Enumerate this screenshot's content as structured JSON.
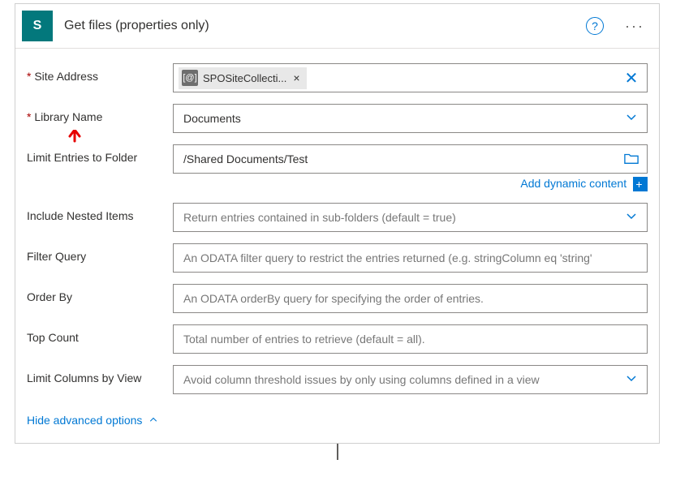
{
  "header": {
    "logo_letter": "S",
    "title": "Get files (properties only)"
  },
  "fields": {
    "site_address": {
      "label": "Site Address",
      "token": "SPOSiteCollecti..."
    },
    "library_name": {
      "label": "Library Name",
      "value": "Documents"
    },
    "limit_folder": {
      "label": "Limit Entries to Folder",
      "value": "/Shared Documents/Test"
    },
    "include_nested": {
      "label": "Include Nested Items",
      "placeholder": "Return entries contained in sub-folders (default = true)"
    },
    "filter_query": {
      "label": "Filter Query",
      "placeholder": "An ODATA filter query to restrict the entries returned (e.g. stringColumn eq 'string'"
    },
    "order_by": {
      "label": "Order By",
      "placeholder": "An ODATA orderBy query for specifying the order of entries."
    },
    "top_count": {
      "label": "Top Count",
      "placeholder": "Total number of entries to retrieve (default = all)."
    },
    "limit_columns": {
      "label": "Limit Columns by View",
      "placeholder": "Avoid column threshold issues by only using columns defined in a view"
    }
  },
  "links": {
    "add_dynamic": "Add dynamic content",
    "advanced_toggle": "Hide advanced options"
  }
}
